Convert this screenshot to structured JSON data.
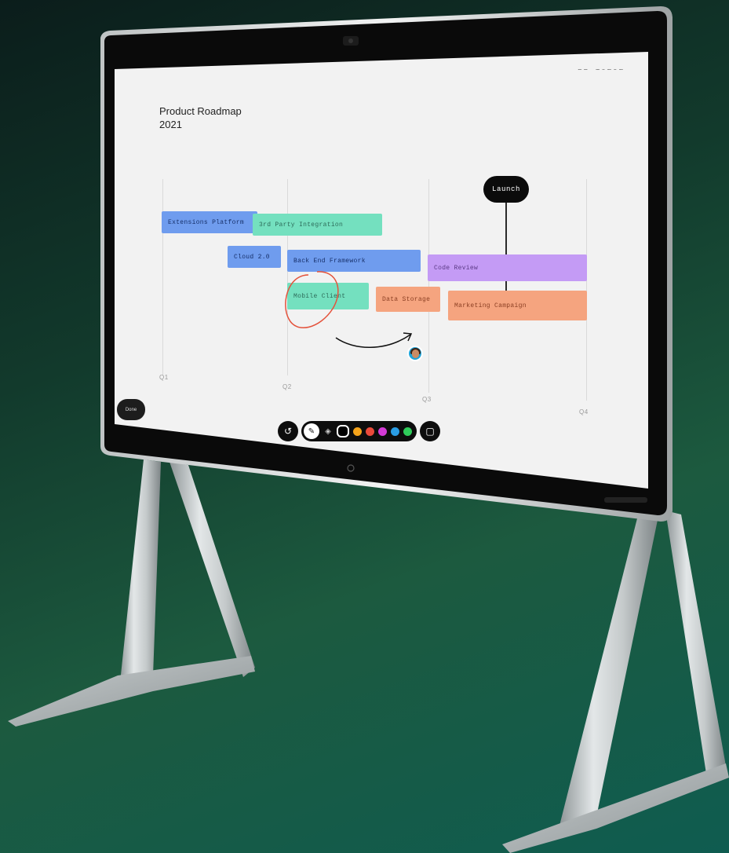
{
  "board": {
    "id": "BB-10292",
    "title_line1": "Product Roadmap",
    "title_line2": "2021"
  },
  "quarters": [
    "Q1",
    "Q2",
    "Q3",
    "Q4"
  ],
  "milestone": {
    "label": "Launch"
  },
  "bars": [
    {
      "label": "Extensions Platform",
      "color": "#6f9cee"
    },
    {
      "label": "3rd Party Integration",
      "color": "#74e0bf"
    },
    {
      "label": "Cloud 2.0",
      "color": "#6f9cee"
    },
    {
      "label": "Back End Framework",
      "color": "#6f9cee"
    },
    {
      "label": "Code Review",
      "color": "#c49bf5"
    },
    {
      "label": "Mobile Client",
      "color": "#74e0bf"
    },
    {
      "label": "Data Storage",
      "color": "#f5a47f"
    },
    {
      "label": "Marketing Campaign",
      "color": "#f5a47f"
    }
  ],
  "controls": {
    "done_label": "Done",
    "undo_icon": "undo-icon",
    "pen_icon": "pen-icon",
    "eraser_icon": "eraser-icon",
    "sticky_icon": "sticky-note-icon"
  },
  "palette": [
    "#000000",
    "#f4a31a",
    "#ea4a3b",
    "#d43ad6",
    "#2a9de4",
    "#2fcc5a"
  ],
  "annotations": {
    "circle_color": "#e4523b",
    "arrow_color": "#111111"
  }
}
